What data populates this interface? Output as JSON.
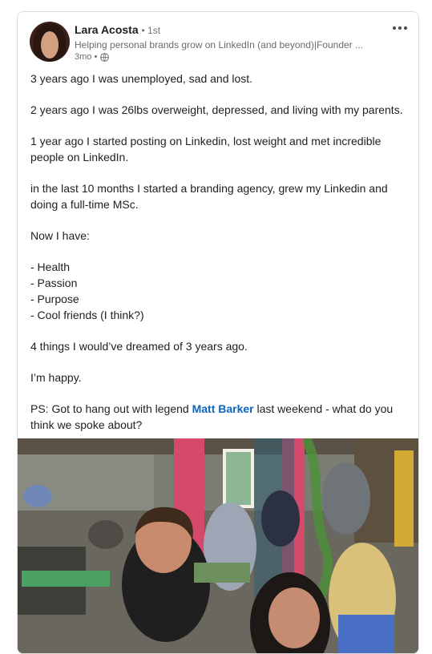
{
  "post": {
    "author": {
      "name": "Lara Acosta",
      "connection": "• 1st",
      "headline": "Helping personal brands grow on LinkedIn (and beyond)|Founder ...",
      "time": "3mo •"
    },
    "paragraphs": [
      [
        "3 years ago I was unemployed, sad and lost."
      ],
      [
        "2 years ago I was 26lbs overweight, depressed, and living with my parents."
      ],
      [
        "1 year ago I started posting on Linkedin, lost weight and met incredible",
        "people on LinkedIn."
      ],
      [
        "in the last 10 months I started a branding agency, grew my Linkedin and",
        "doing a full-time MSc."
      ],
      [
        "Now I have:"
      ],
      [
        "- Health",
        "- Passion",
        "- Purpose",
        "- Cool friends (I think?)"
      ],
      [
        "4 things I would’ve dreamed of 3 years ago."
      ],
      [
        "I’m happy."
      ]
    ],
    "ps": {
      "before": "PS: Got to hang out with legend ",
      "mention": "Matt Barker",
      "after": " last weekend - what do you",
      "line2": "think we spoke about?"
    },
    "icons": {
      "visibility": "globe-icon",
      "menu": "more-icon"
    },
    "colors": {
      "link": "#0a66c2",
      "card_border": "#dcdcdc",
      "secondary_text": "#6b6b6b"
    }
  }
}
